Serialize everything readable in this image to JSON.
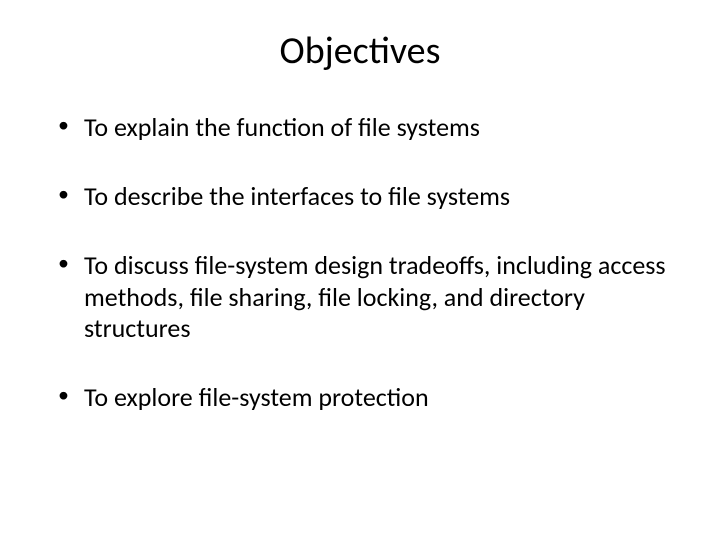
{
  "slide": {
    "title": "Objectives",
    "bullets": [
      "To explain the function of file systems",
      "To describe the interfaces to file systems",
      "To discuss file-system design tradeoffs, including access methods, file sharing, file locking, and directory structures",
      "To explore file-system protection"
    ]
  }
}
